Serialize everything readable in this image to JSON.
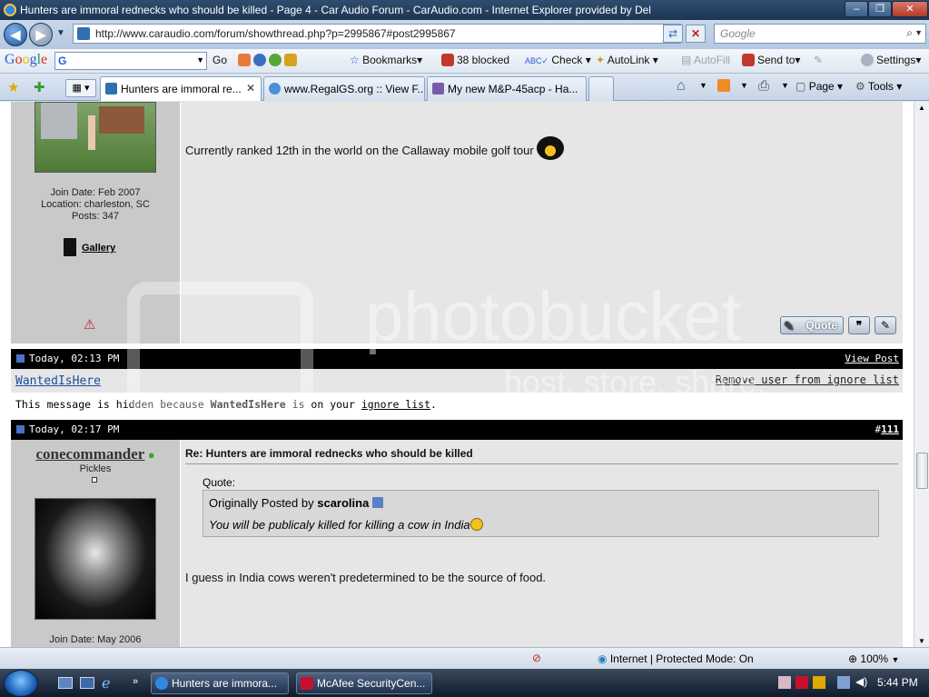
{
  "window": {
    "title": "Hunters are immoral rednecks who should be killed - Page 4 - Car Audio Forum - CarAudio.com - Internet Explorer provided by Del",
    "minimize_glyph": "–",
    "restore_glyph": "❐",
    "close_glyph": "✕"
  },
  "address_bar": {
    "url": "http://www.caraudio.com/forum/showthread.php?p=2995867#post2995867",
    "search_placeholder": "Google"
  },
  "google_toolbar": {
    "logo": "Google",
    "search_prefix": "G",
    "go_label": "Go",
    "bookmarks_label": "Bookmarks▾",
    "blocked_label": "38 blocked",
    "check_label": "Check ▾",
    "autolink_label": "AutoLink ▾",
    "autofill_label": "AutoFill",
    "sendto_label": "Send to▾",
    "settings_label": "Settings▾"
  },
  "tabs": [
    {
      "label": "Hunters are immoral re...",
      "active": true
    },
    {
      "label": "www.RegalGS.org :: View F...",
      "active": false
    },
    {
      "label": "My new M&P-45acp - Ha...",
      "active": false
    }
  ],
  "command_bar": {
    "page_label": "Page ▾",
    "tools_label": "Tools ▾"
  },
  "post_prev": {
    "signature": "Currently ranked 12th in the world on the Callaway mobile golf tour",
    "join_date": "Join Date: Feb 2007",
    "location": "Location: charleston, SC",
    "posts": "Posts: 347",
    "gallery_label": "Gallery",
    "quote_button": "Quote"
  },
  "hidden_post": {
    "timestamp": "Today, 02:13 PM",
    "view_post": "View Post",
    "username": "WantedIsHere",
    "remove_ignore": "Remove user from ignore list",
    "message_prefix": "This message is hidden because ",
    "message_user": "WantedIsHere",
    "message_mid": " is on your ",
    "ignore_link": "ignore list",
    "message_end": "."
  },
  "post_111": {
    "timestamp": "Today, 02:17 PM",
    "post_number_prefix": "#",
    "post_number": "111",
    "username": "conecommander",
    "user_title": "Pickles",
    "join_date": "Join Date: May 2006",
    "title": "Re: Hunters are immoral rednecks who should be killed",
    "quote_label": "Quote:",
    "quote_origin_prefix": "Originally Posted by ",
    "quote_origin_user": "scarolina",
    "quote_text": "You will be publicaly killed for killing a cow in India",
    "body": "I guess in India cows weren't predetermined to be the source of food."
  },
  "status_bar": {
    "zone": "Internet | Protected Mode: On",
    "zoom": "100%"
  },
  "taskbar": {
    "items": [
      {
        "label": "Hunters are immora..."
      },
      {
        "label": "McAfee SecurityCen..."
      }
    ],
    "clock": "5:44 PM"
  },
  "watermark": {
    "text": "photobucket",
    "subtext": "host. store. share."
  },
  "colors": {
    "accent_link": "#1a4fa0",
    "bar_black": "#000000",
    "pane_gray": "#c9c9c9"
  }
}
